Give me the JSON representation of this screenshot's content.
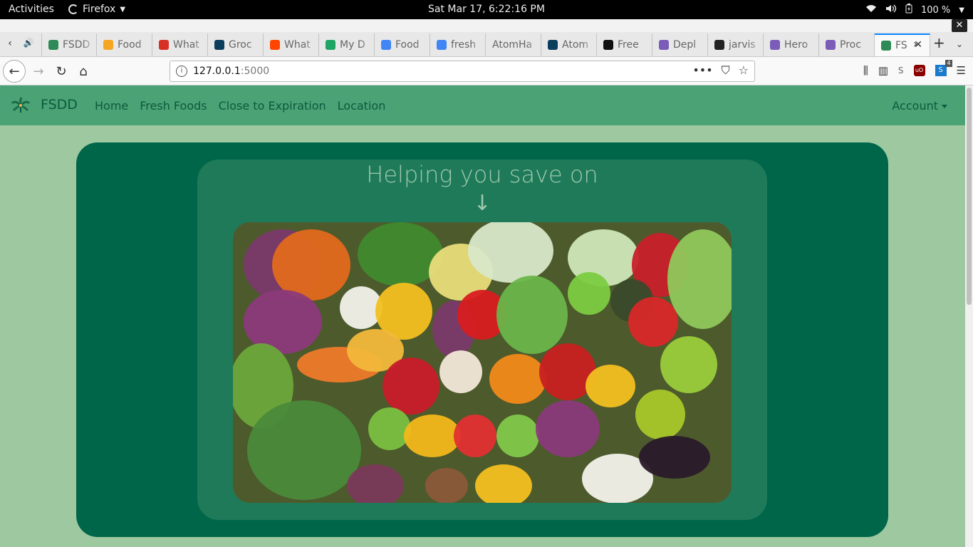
{
  "system_bar": {
    "activities": "Activities",
    "app_name": "Firefox",
    "clock": "Sat Mar 17,  6:22:16 PM",
    "battery": "100 %"
  },
  "browser": {
    "tabs": [
      {
        "title": "FSDD",
        "favicon": "palm-icon",
        "color": "#2e8b57"
      },
      {
        "title": "Food",
        "favicon": "firebase-icon",
        "color": "#f5a623"
      },
      {
        "title": "What",
        "favicon": "gmail-icon",
        "color": "#d93025"
      },
      {
        "title": "Groc",
        "favicon": "d-icon",
        "color": "#0b3d5c"
      },
      {
        "title": "What",
        "favicon": "reddit-icon",
        "color": "#ff4500"
      },
      {
        "title": "My D",
        "favicon": "drive-icon",
        "color": "#1fa463"
      },
      {
        "title": "Food",
        "favicon": "docs-icon",
        "color": "#4285f4"
      },
      {
        "title": "fresh",
        "favicon": "google-icon",
        "color": "#4285f4"
      },
      {
        "title": "AtomHa",
        "favicon": "",
        "color": ""
      },
      {
        "title": "Atom",
        "favicon": "d-icon",
        "color": "#0b3d5c"
      },
      {
        "title": "Free",
        "favicon": "ff-icon",
        "color": "#111111"
      },
      {
        "title": "Depl",
        "favicon": "heroku-icon",
        "color": "#7b5cb8"
      },
      {
        "title": "jarvis",
        "favicon": "github-icon",
        "color": "#222222"
      },
      {
        "title": "Hero",
        "favicon": "heroku-icon",
        "color": "#7b5cb8"
      },
      {
        "title": "Proc",
        "favicon": "heroku-icon",
        "color": "#7b5cb8"
      },
      {
        "title": "FS",
        "favicon": "palm-icon",
        "color": "#2e8b57",
        "active": true
      }
    ],
    "url_host": "127.0.0.1",
    "url_port": ":5000",
    "extension_badge": "4"
  },
  "site": {
    "brand": "FSDD",
    "nav_links": [
      "Home",
      "Fresh Foods",
      "Close to Expiration",
      "Location"
    ],
    "account_label": "Account",
    "hero_title": "Helping you save on",
    "hero_arrow": "↓"
  },
  "colors": {
    "page_bg": "#9dc8a0",
    "nav_bg": "#4ba275",
    "hero_outer": "#00664a",
    "hero_inner": "#1f7a5a",
    "hero_text": "#9cc9ab"
  }
}
